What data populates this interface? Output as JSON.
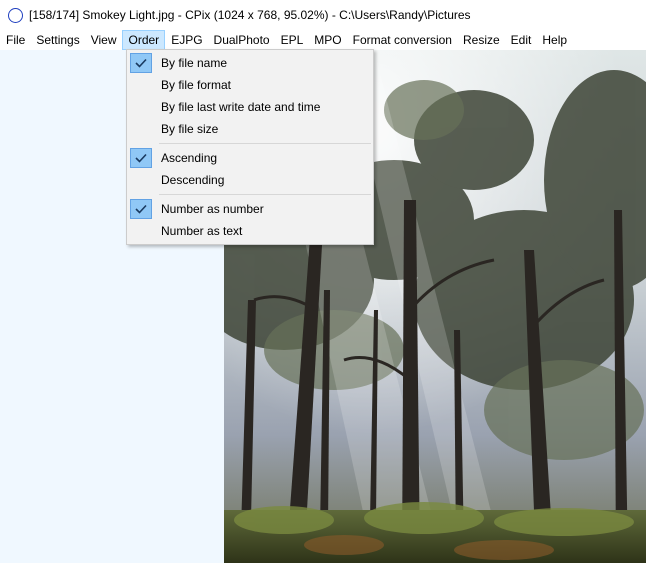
{
  "window": {
    "title": "[158/174] Smokey Light.jpg - CPix (1024 x 768, 95.02%) - C:\\Users\\Randy\\Pictures"
  },
  "menubar": {
    "items": [
      {
        "label": "File"
      },
      {
        "label": "Settings"
      },
      {
        "label": "View"
      },
      {
        "label": "Order",
        "active": true
      },
      {
        "label": "EJPG"
      },
      {
        "label": "DualPhoto"
      },
      {
        "label": "EPL"
      },
      {
        "label": "MPO"
      },
      {
        "label": "Format conversion"
      },
      {
        "label": "Resize"
      },
      {
        "label": "Edit"
      },
      {
        "label": "Help"
      }
    ]
  },
  "order_menu": {
    "groups": [
      [
        {
          "label": "By file name",
          "checked": true
        },
        {
          "label": "By file format",
          "checked": false
        },
        {
          "label": "By file last write date and time",
          "checked": false
        },
        {
          "label": "By file size",
          "checked": false
        }
      ],
      [
        {
          "label": "Ascending",
          "checked": true
        },
        {
          "label": "Descending",
          "checked": false
        }
      ],
      [
        {
          "label": "Number as number",
          "checked": true
        },
        {
          "label": "Number as text",
          "checked": false
        }
      ]
    ]
  },
  "colors": {
    "menu_active_bg": "#cce8ff",
    "check_bg": "#90c8f6",
    "left_panel_bg": "#f0f8ff"
  },
  "icons": {
    "app": "circle-icon",
    "check": "checkmark-icon"
  }
}
